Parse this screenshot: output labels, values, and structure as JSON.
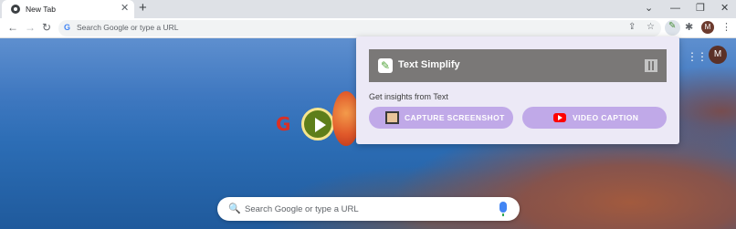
{
  "tab": {
    "title": "New Tab",
    "close": "✕"
  },
  "tabstrip": {
    "new_tab": "+",
    "chevron": "⌄",
    "minimize": "—",
    "restore": "❐",
    "close": "✕"
  },
  "toolbar": {
    "back": "←",
    "forward": "→",
    "reload": "↻",
    "omnibox_placeholder": "Search Google or type a URL",
    "share": "⇪",
    "star": "☆",
    "puzzle": "✱",
    "profile": "M",
    "menu": "⋮"
  },
  "page": {
    "apps": "⋮⋮⋮",
    "avatar": "M",
    "doodle_letter": "G",
    "search_placeholder": "Search Google or type a URL",
    "search_icon": "🔍"
  },
  "popup": {
    "title": "Text Simplify",
    "subtitle": "Get insights from Text",
    "capture_label": "CAPTURE SCREENSHOT",
    "video_label": "VIDEO CAPTION"
  },
  "colors": {
    "popup_bg": "#ece9f6",
    "header_bg": "#7a7877",
    "button_bg": "#c0a9e8"
  }
}
